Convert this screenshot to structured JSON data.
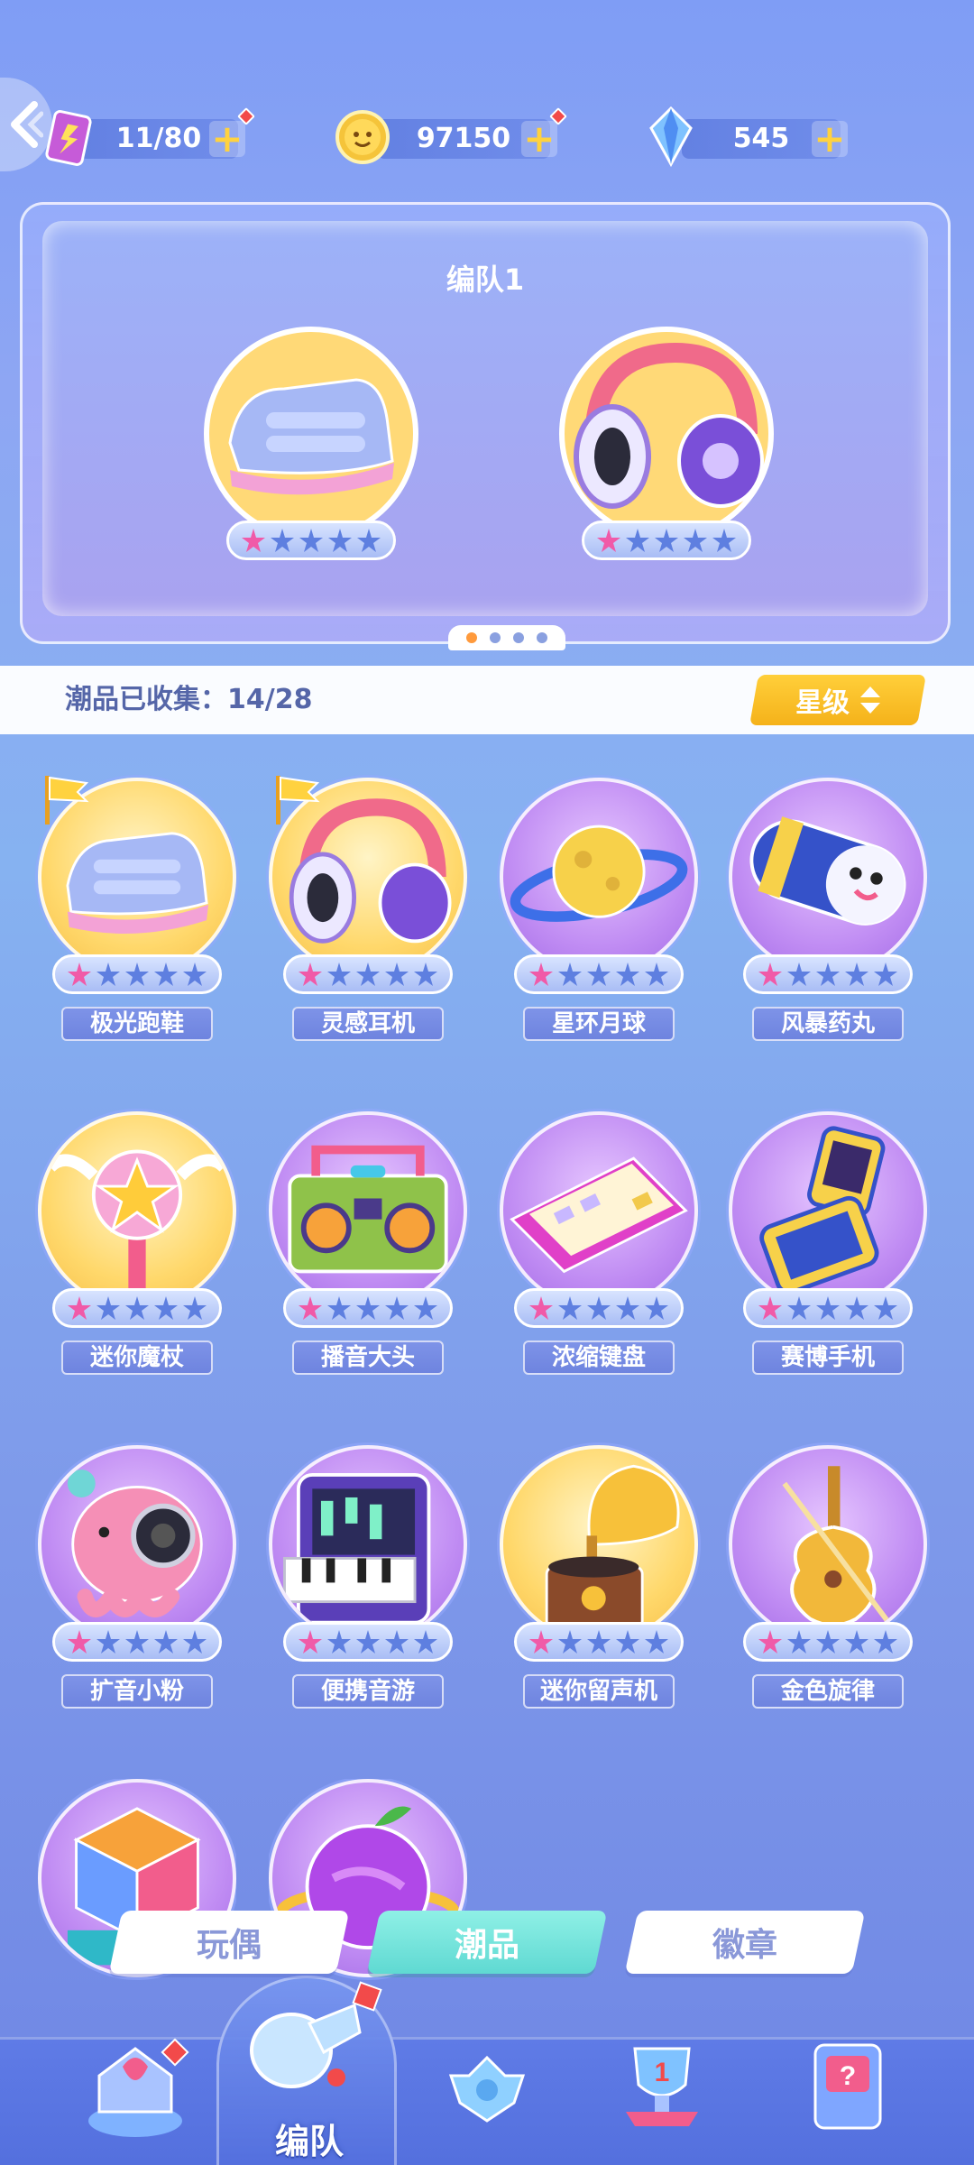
{
  "resources": {
    "energy": {
      "value": "11/80",
      "icon": "energy-card-icon"
    },
    "coins": {
      "value": "97150",
      "icon": "coin-icon"
    },
    "gems": {
      "value": "545",
      "icon": "crystal-icon"
    }
  },
  "team": {
    "title": "编队1",
    "slots": [
      {
        "item": "sneaker",
        "stars": 1
      },
      {
        "item": "headphones",
        "stars": 1
      }
    ],
    "pages": 4,
    "current_page": 1
  },
  "collection": {
    "label": "潮品已收集：14/28",
    "sort_label": "星级"
  },
  "items": [
    {
      "name": "极光跑鞋",
      "bg": "gold",
      "icon": "sneaker-icon",
      "flag": true,
      "stars": 1
    },
    {
      "name": "灵感耳机",
      "bg": "gold",
      "icon": "headphones-icon",
      "flag": true,
      "stars": 1
    },
    {
      "name": "星环月球",
      "bg": "purple",
      "icon": "ringed-planet-icon",
      "flag": false,
      "stars": 1
    },
    {
      "name": "风暴药丸",
      "bg": "purple",
      "icon": "pill-icon",
      "flag": false,
      "stars": 1
    },
    {
      "name": "迷你魔杖",
      "bg": "gold",
      "icon": "magic-wand-icon",
      "flag": false,
      "stars": 1
    },
    {
      "name": "播音大头",
      "bg": "purple",
      "icon": "boombox-icon",
      "flag": false,
      "stars": 1
    },
    {
      "name": "浓缩键盘",
      "bg": "purple",
      "icon": "keyboard-icon",
      "flag": false,
      "stars": 1
    },
    {
      "name": "赛博手机",
      "bg": "purple",
      "icon": "flip-phone-icon",
      "flag": false,
      "stars": 1
    },
    {
      "name": "扩音小粉",
      "bg": "purple",
      "icon": "octopus-speaker-icon",
      "flag": false,
      "stars": 1
    },
    {
      "name": "便携音游",
      "bg": "purple",
      "icon": "piano-console-icon",
      "flag": false,
      "stars": 1
    },
    {
      "name": "迷你留声机",
      "bg": "gold",
      "icon": "gramophone-icon",
      "flag": false,
      "stars": 1
    },
    {
      "name": "金色旋律",
      "bg": "purple",
      "icon": "violin-icon",
      "flag": false,
      "stars": 1
    },
    {
      "name": "",
      "bg": "purple",
      "icon": "cube-icon",
      "flag": false,
      "stars": 0
    },
    {
      "name": "",
      "bg": "purple",
      "icon": "fruit-planet-icon",
      "flag": false,
      "stars": 0
    }
  ],
  "tabs": [
    {
      "label": "玩偶",
      "active": false
    },
    {
      "label": "潮品",
      "active": true
    },
    {
      "label": "徽章",
      "active": false
    }
  ],
  "bottom_nav": {
    "center_label": "编队",
    "items": [
      "home-icon",
      "whistle-icon",
      "controller-icon",
      "trophy-icon",
      "help-machine-icon"
    ]
  },
  "colors": {
    "accent_gold": "#f5b21a",
    "active_tab": "#5fd9d2",
    "pager_active": "#ff9a3c"
  }
}
